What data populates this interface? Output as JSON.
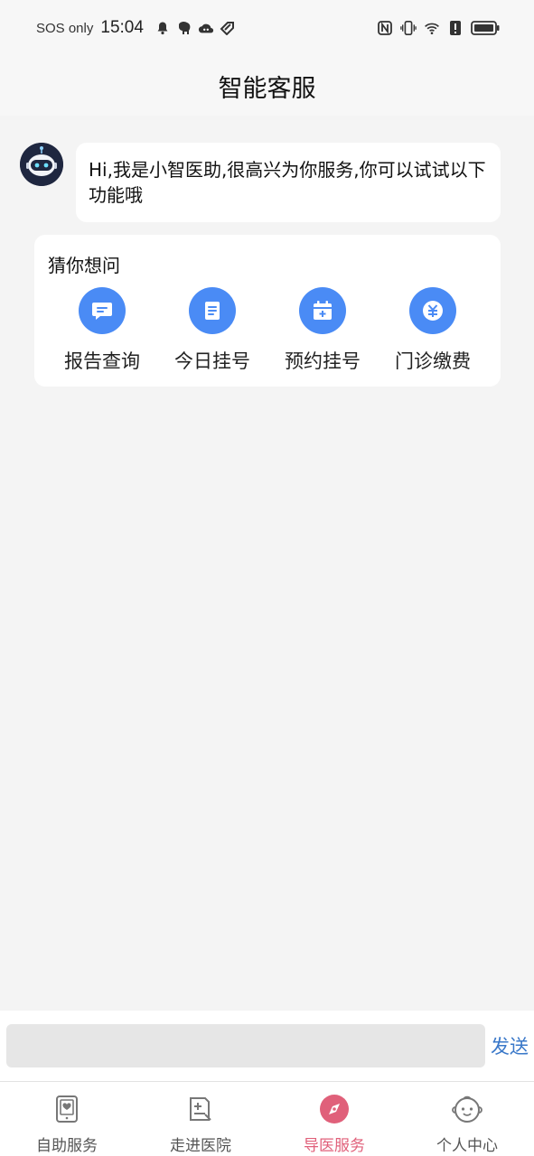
{
  "status_bar": {
    "carrier": "SOS only",
    "time": "15:04",
    "icons_left": [
      "bell-icon",
      "elephant-app-icon",
      "cloud-app-icon",
      "tag-app-icon"
    ],
    "icons_right": [
      "nfc-icon",
      "vibrate-icon",
      "wifi-icon",
      "alert-icon",
      "battery-icon"
    ]
  },
  "header": {
    "title": "智能客服"
  },
  "chat": {
    "bot_message": "Hi,我是小智医助,很高兴为你服务,你可以试试以下功能哦"
  },
  "guess": {
    "title": "猜你想问",
    "items": [
      {
        "label": "报告查询",
        "icon": "report-chat-icon"
      },
      {
        "label": "今日挂号",
        "icon": "document-icon"
      },
      {
        "label": "预约挂号",
        "icon": "calendar-plus-icon"
      },
      {
        "label": "门诊缴费",
        "icon": "yuan-coin-icon"
      }
    ]
  },
  "input": {
    "placeholder": "",
    "value": "",
    "send_label": "发送"
  },
  "bottom_nav": {
    "active_color": "#e0607a",
    "items": [
      {
        "label": "自助服务",
        "icon": "tablet-heart-icon"
      },
      {
        "label": "走进医院",
        "icon": "hospital-doc-icon"
      },
      {
        "label": "导医服务",
        "icon": "compass-icon",
        "active": true
      },
      {
        "label": "个人中心",
        "icon": "baby-face-icon"
      }
    ]
  },
  "colors": {
    "accent_blue": "#4a8bf5",
    "send_blue": "#3a78c9",
    "background": "#f4f4f4"
  }
}
